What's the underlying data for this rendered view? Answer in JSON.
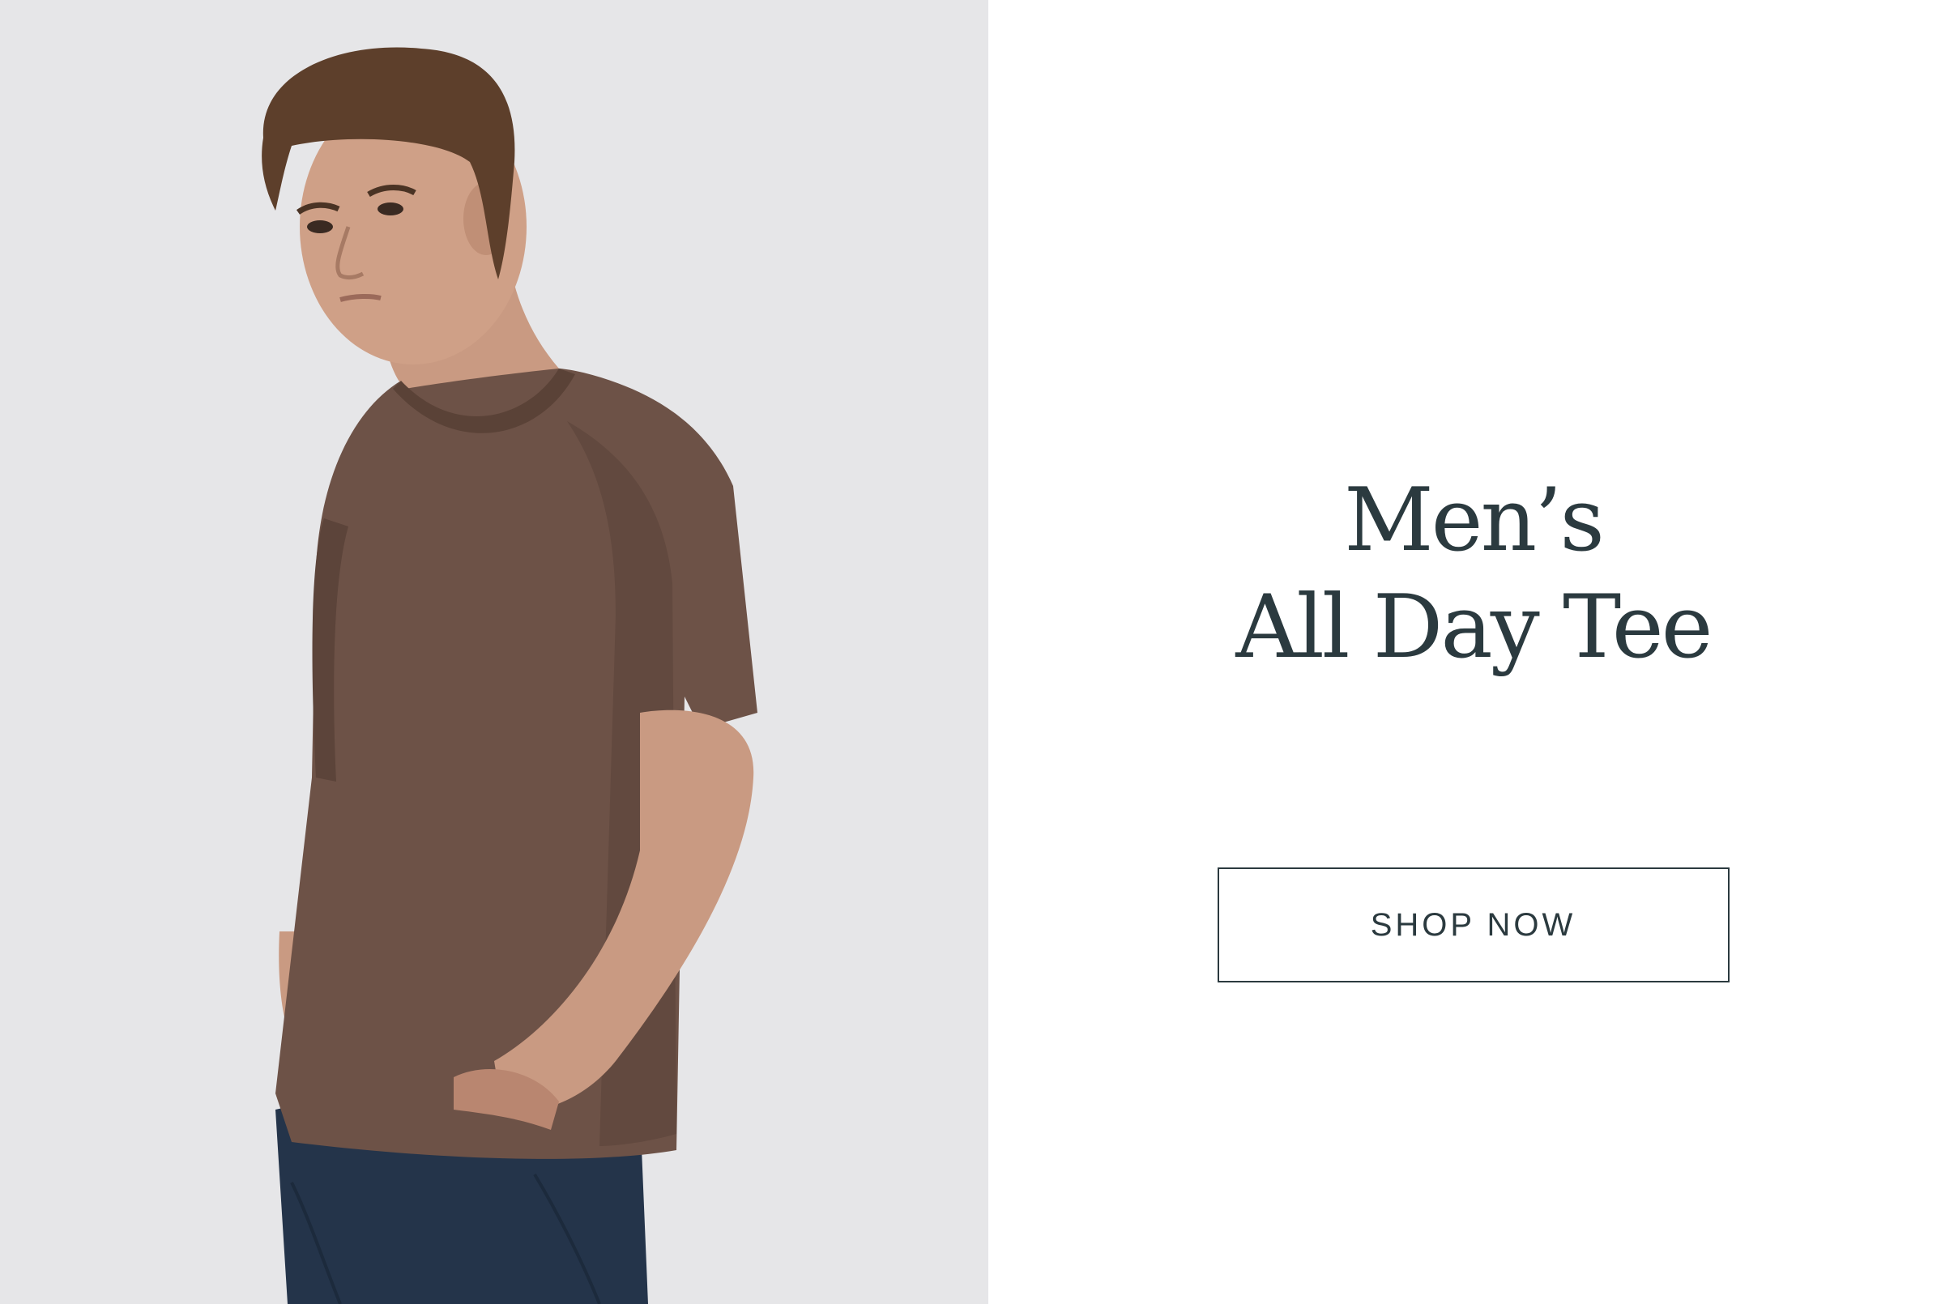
{
  "hero": {
    "title_line1": "Men’s",
    "title_line2": "All Day Tee",
    "cta_label": "SHOP NOW",
    "image_description_icon": "model-photo",
    "colors": {
      "image_background": "#e6e6e8",
      "page_background": "#ffffff",
      "text": "#2b3a3f",
      "shirt": "#6d5247",
      "jeans": "#24344a"
    }
  }
}
